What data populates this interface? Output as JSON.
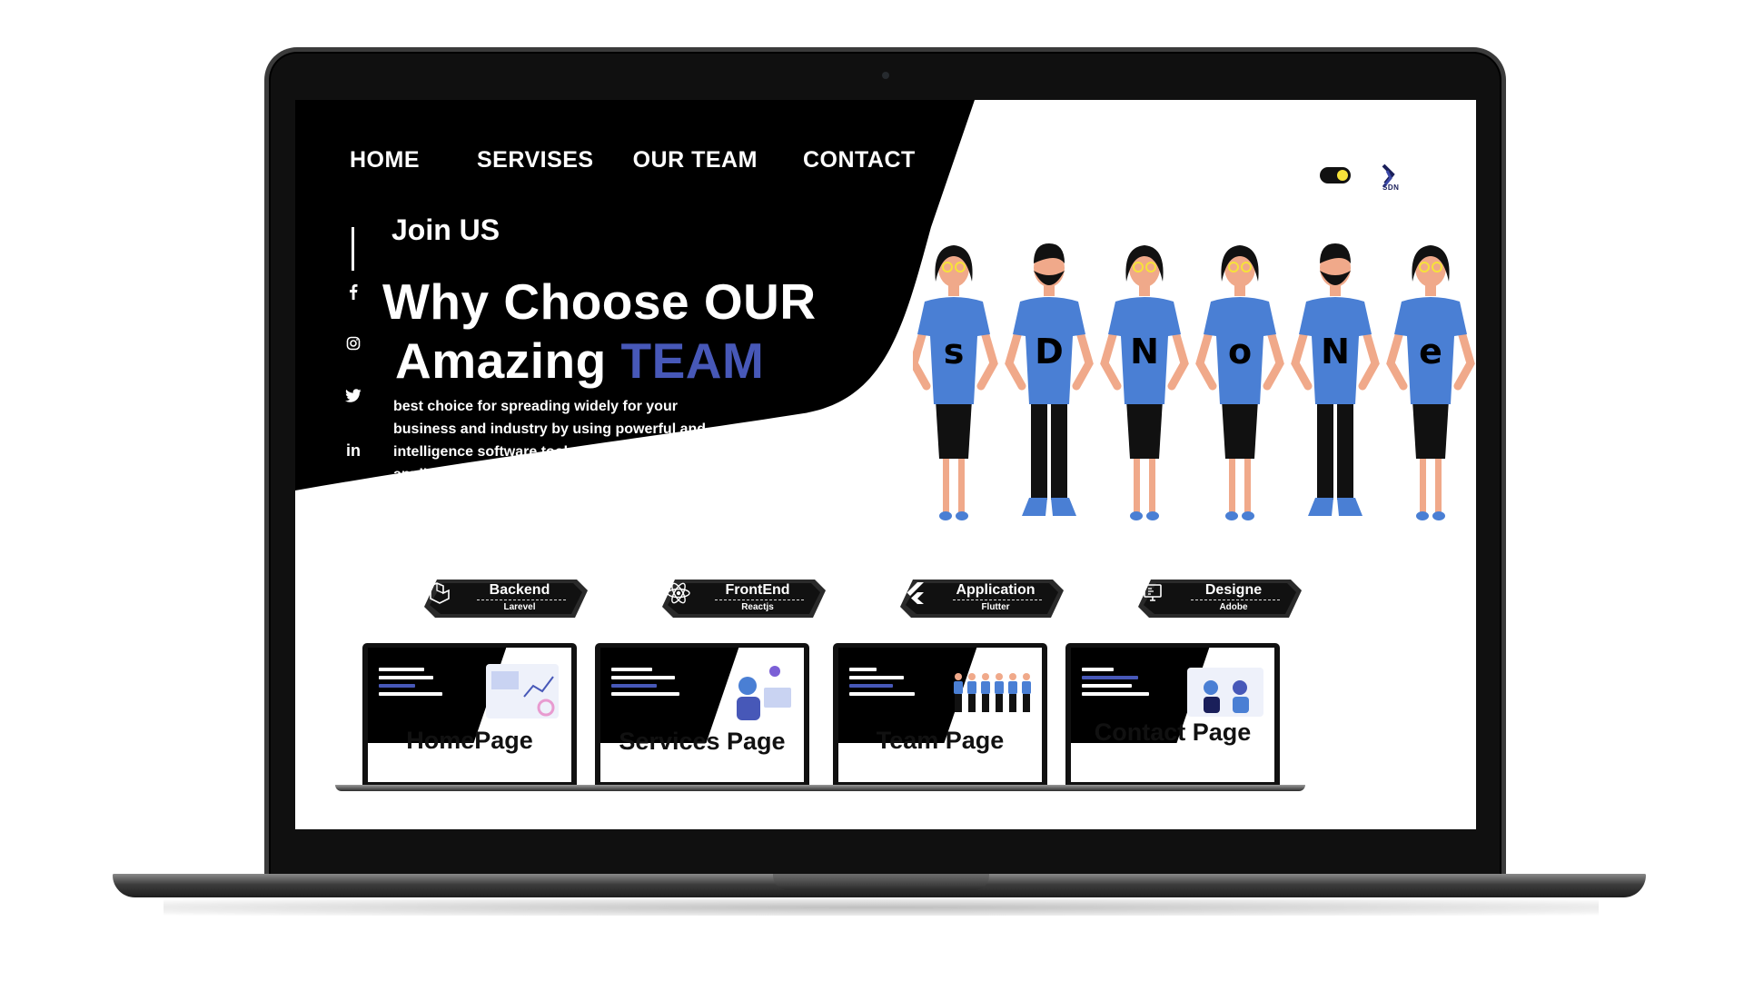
{
  "nav": {
    "home": "HOME",
    "services": "SERVISES",
    "team": "OUR TEAM",
    "contact": "CONTACT"
  },
  "brand": {
    "logo_text": "SDN"
  },
  "hero": {
    "kicker": "Join US",
    "title_line1": "Why Choose OUR",
    "title_line2_prefix": "Amazing",
    "title_line2_accent": "TEAM",
    "description": "best choice for spreading widely for your business and industry by using powerful and intelligence software tools to build your application"
  },
  "team_letters": [
    "s",
    "D",
    "N",
    "o",
    "N",
    "e"
  ],
  "social": [
    "facebook-icon",
    "instagram-icon",
    "twitter-icon",
    "linkedin-icon"
  ],
  "social_linkedin_glyph": "in",
  "badges": [
    {
      "title": "Backend",
      "subtitle": "Larevel",
      "icon": "laravel-icon"
    },
    {
      "title": "FrontEnd",
      "subtitle": "Reactjs",
      "icon": "react-icon"
    },
    {
      "title": "Application",
      "subtitle": "Flutter",
      "icon": "flutter-icon"
    },
    {
      "title": "Designe",
      "subtitle": "Adobe",
      "icon": "design-icon"
    }
  ],
  "previews": [
    {
      "label": "HomePage"
    },
    {
      "label": "Services Page"
    },
    {
      "label": "Team Page"
    },
    {
      "label": "Contact Page"
    }
  ],
  "colors": {
    "accent": "#4758b8",
    "dark": "#000000",
    "shirt": "#4a7fd4",
    "toggle_knob": "#f6e23a"
  }
}
